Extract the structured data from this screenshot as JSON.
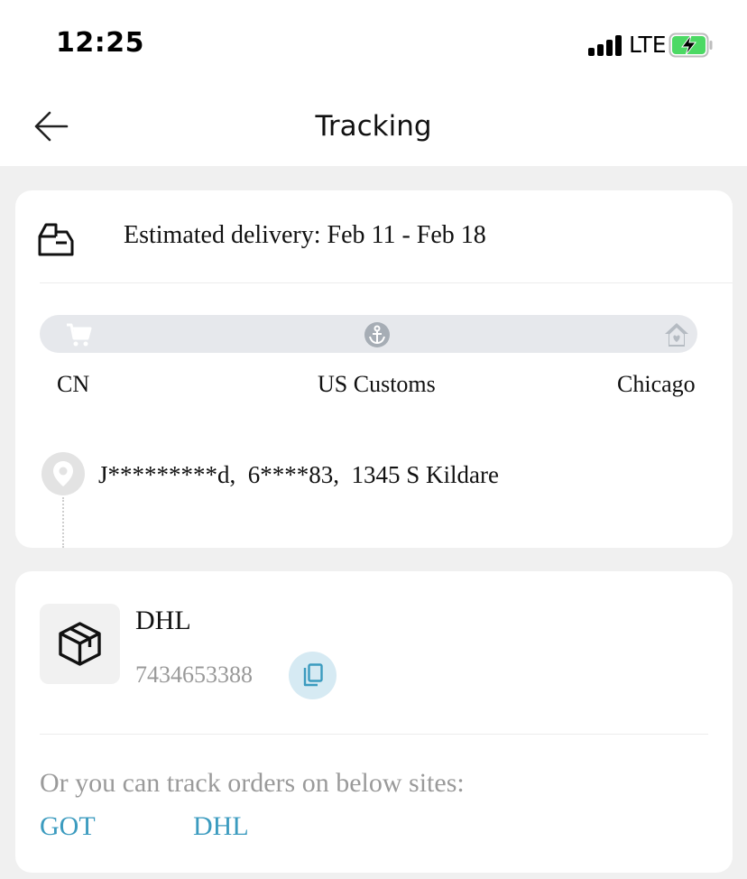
{
  "status_bar": {
    "time": "12:25",
    "network": "LTE"
  },
  "header": {
    "title": "Tracking"
  },
  "delivery": {
    "estimated_text": "Estimated delivery: Feb 11 - Feb 18"
  },
  "progress": {
    "stages": [
      {
        "label": "CN",
        "icon": "cart-icon"
      },
      {
        "label": "US Customs",
        "icon": "anchor-icon"
      },
      {
        "label": "Chicago",
        "icon": "home-icon"
      }
    ]
  },
  "shipping_address": {
    "text": "J*********d,  6****83,  1345 S Kildare"
  },
  "shipment": {
    "carrier": "DHL",
    "tracking_number": "7434653388"
  },
  "other_sites": {
    "intro": "Or you can track orders on below sites:",
    "links": [
      {
        "label": "GOT"
      },
      {
        "label": "DHL"
      }
    ]
  },
  "colors": {
    "link": "#3b9bbf",
    "copy_bg": "#d6eaf3",
    "battery_fill": "#4cd964",
    "background": "#f0f0f0"
  }
}
